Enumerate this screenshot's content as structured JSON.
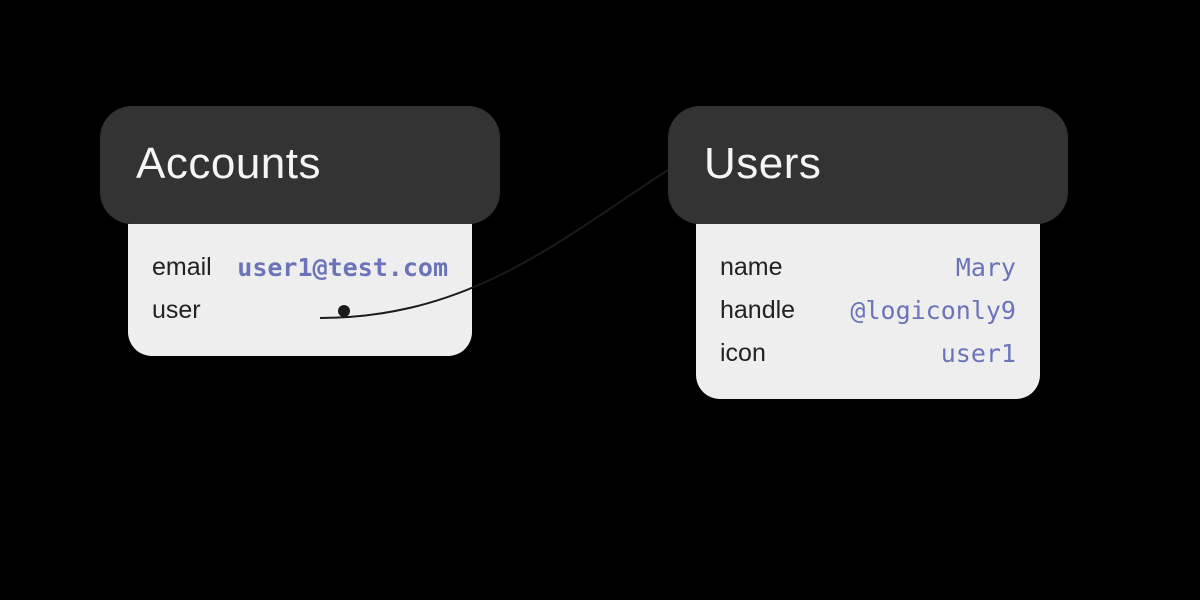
{
  "cards": {
    "accounts": {
      "title": "Accounts",
      "rows": [
        {
          "key": "email",
          "val": "user1@test.com",
          "bold": true
        },
        {
          "key": "user",
          "ref": true
        }
      ]
    },
    "users": {
      "title": "Users",
      "rows": [
        {
          "key": "name",
          "val": "Mary"
        },
        {
          "key": "handle",
          "val": "@logiconly9"
        },
        {
          "key": "icon",
          "val": "user1"
        }
      ]
    }
  },
  "colors": {
    "header_bg": "#333333",
    "header_fg": "#f5f5f5",
    "body_bg": "#eeeeee",
    "value_fg": "#6b74b8"
  }
}
